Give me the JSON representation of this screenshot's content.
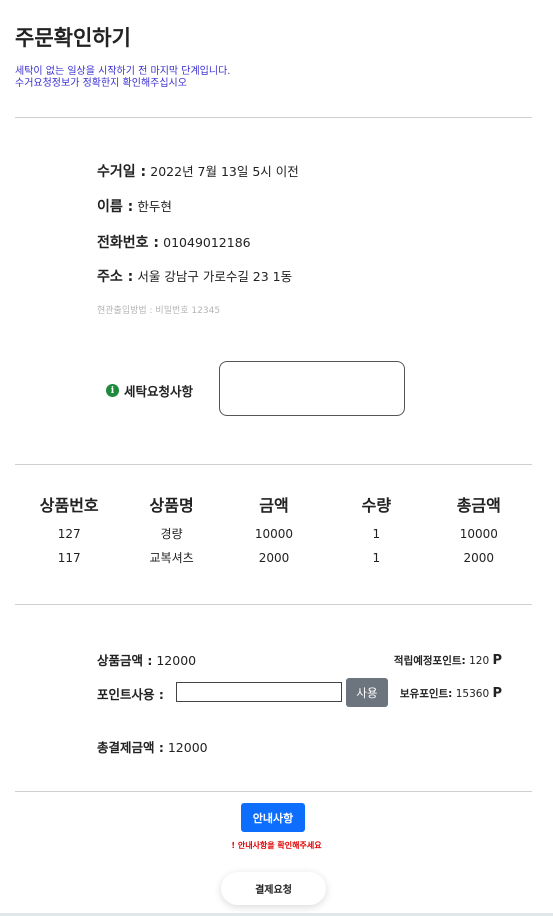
{
  "header": {
    "title": "주문확인하기",
    "subtitle_line1": "세탁이 없는 일상을 시작하기 전 마지막 단계입니다.",
    "subtitle_line2": "수거요청정보가 정확한지 확인해주십시오"
  },
  "info": {
    "pickup_label": "수거일 :",
    "pickup_value": "2022년 7월 13일 5시 이전",
    "name_label": "이름 :",
    "name_value": "한두현",
    "phone_label": "전화번호 :",
    "phone_value": "01049012186",
    "address_label": "주소 :",
    "address_value": "서울 강남구 가로수길 23  1동",
    "entrance": "현관출입방법 : 비밀번호 12345"
  },
  "request": {
    "label": "세탁요청사항",
    "icon": "info-circle-icon",
    "value": ""
  },
  "goods": {
    "headers": [
      "상품번호",
      "상품명",
      "금액",
      "수량",
      "총금액"
    ],
    "rows": [
      [
        "127",
        "경량",
        "10000",
        "1",
        "10000"
      ],
      [
        "117",
        "교복셔츠",
        "2000",
        "1",
        "2000"
      ]
    ]
  },
  "summary": {
    "product_amount_label": "상품금액 :",
    "product_amount_value": "12000",
    "expected_points_label": "적립예정포인트:",
    "expected_points_value": "120",
    "points_unit": "P",
    "point_use_label": "포인트사용 :",
    "point_use_value": "",
    "use_button": "사용",
    "owned_points_label": "보유포인트:",
    "owned_points_value": "15360",
    "total_label": "총결제금액 :",
    "total_value": "12000"
  },
  "actions": {
    "guide_button": "안내사항",
    "guide_warning": "! 안내사항을 확인해주세요",
    "pay_button": "결제요청"
  },
  "colors": {
    "subtitle": "#3a2fd0",
    "primary_button": "#0d6efd",
    "secondary_button": "#6c757d",
    "warning": "#e00000",
    "info_icon": "#1e8a3e"
  }
}
